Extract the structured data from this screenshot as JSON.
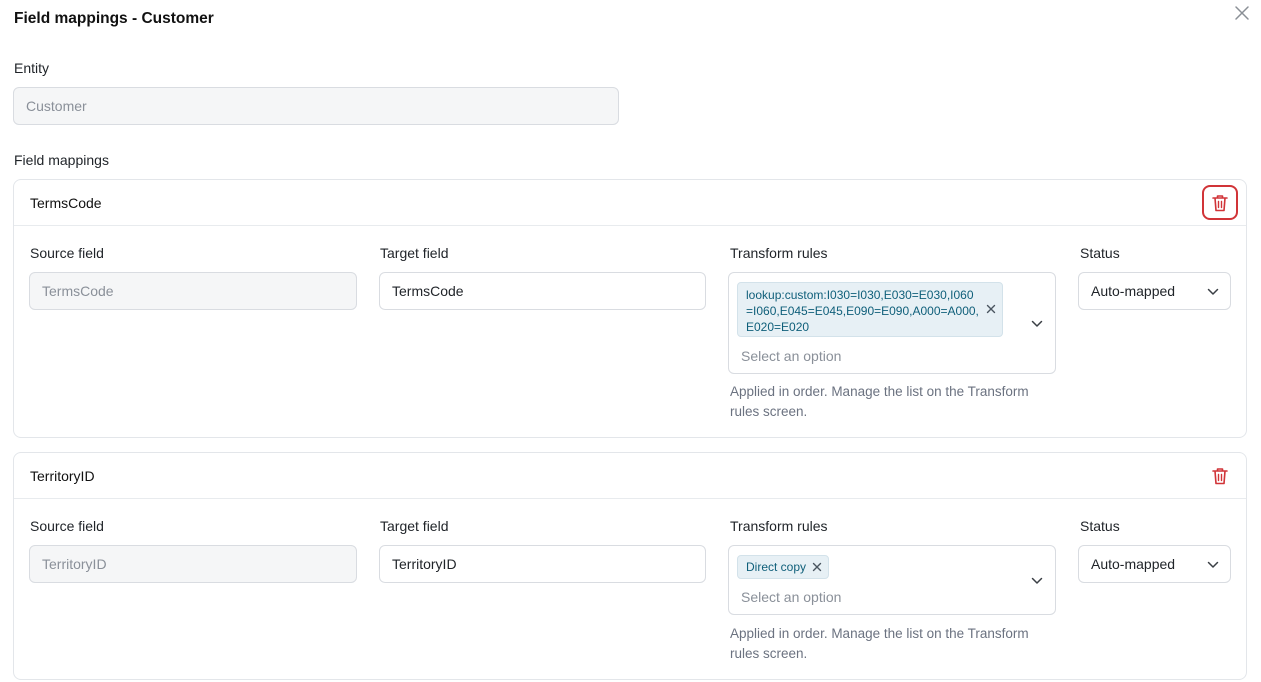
{
  "dialog": {
    "title": "Field mappings - Customer",
    "close_icon": "close-icon"
  },
  "entity": {
    "label": "Entity",
    "value": "Customer"
  },
  "field_mappings_label": "Field mappings",
  "mappings": [
    {
      "name": "TermsCode",
      "source_label": "Source field",
      "source_value": "TermsCode",
      "target_label": "Target field",
      "target_value": "TermsCode",
      "transform_label": "Transform rules",
      "transform_tags": [
        "lookup:custom:I030=I030,E030=E030,I060=I060,E045=E045,E090=E090,A000=A000,E020=E020"
      ],
      "transform_placeholder": "Select an option",
      "transform_help": "Applied in order. Manage the list on the Transform rules screen.",
      "status_label": "Status",
      "status_value": "Auto-mapped"
    },
    {
      "name": "TerritoryID",
      "source_label": "Source field",
      "source_value": "TerritoryID",
      "target_label": "Target field",
      "target_value": "TerritoryID",
      "transform_label": "Transform rules",
      "transform_tags": [
        "Direct copy"
      ],
      "transform_placeholder": "Select an option",
      "transform_help": "Applied in order. Manage the list on the Transform rules screen.",
      "status_label": "Status",
      "status_value": "Auto-mapped"
    }
  ],
  "colors": {
    "delete": "#d13438",
    "tag_bg": "#e7f0f5",
    "tag_text": "#0f5f7a"
  }
}
